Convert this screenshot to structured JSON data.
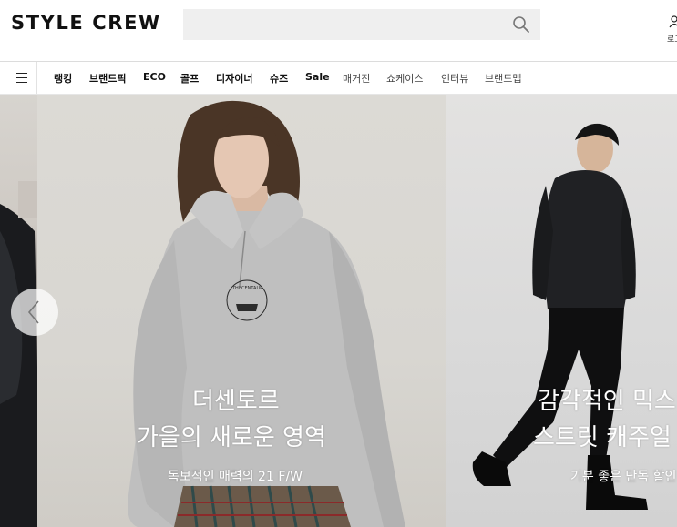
{
  "header": {
    "logo": "STYLE CREW",
    "search": {
      "value": "",
      "placeholder": ""
    },
    "util_label": "로그인"
  },
  "nav": {
    "items": [
      {
        "label": "랭킹",
        "weight": "bold"
      },
      {
        "label": "브랜드픽",
        "weight": "bold"
      },
      {
        "label": "ECO",
        "weight": "bold"
      },
      {
        "label": "골프",
        "weight": "bold"
      },
      {
        "label": "디자이너",
        "weight": "bold"
      },
      {
        "label": "슈즈",
        "weight": "bold"
      },
      {
        "label": "Sale",
        "weight": "bold"
      },
      {
        "label": "매거진",
        "weight": "normal"
      },
      {
        "label": "쇼케이스",
        "weight": "normal"
      },
      {
        "label": "인터뷰",
        "weight": "normal"
      },
      {
        "label": "브랜드맵",
        "weight": "normal"
      }
    ]
  },
  "slides": {
    "center": {
      "title1": "더센토르",
      "title2": "가을의 새로운 영역",
      "subtitle": "독보적인 매력의 21 F/W",
      "sweatshirt_print": "THECENTAUR"
    },
    "right": {
      "title1": "감각적인 믹스",
      "title2": "스트릿 캐주얼",
      "subtitle": "기분 좋은 단독 할인"
    }
  },
  "icons": {
    "menu": "hamburger-icon",
    "search": "search-icon",
    "prev": "chevron-left-icon",
    "user": "user-icon"
  },
  "colors": {
    "brand_text": "#111111",
    "search_bg": "#efefef"
  }
}
